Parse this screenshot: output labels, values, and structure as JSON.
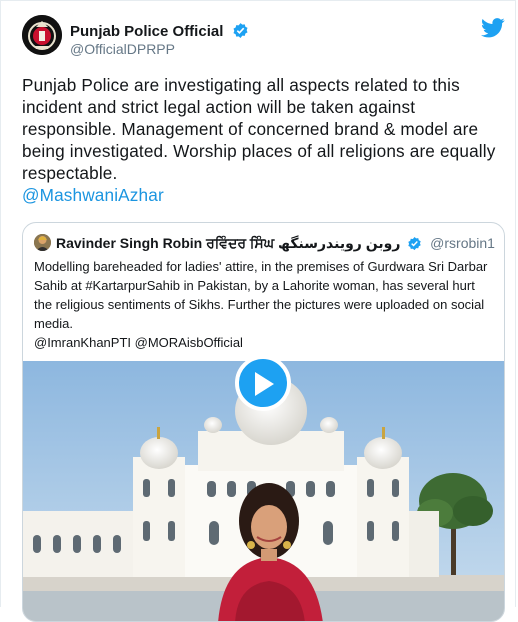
{
  "author": {
    "display_name": "Punjab Police Official",
    "handle": "@OfficialDPRPP",
    "avatar_icon": "punjab-police-emblem-icon",
    "verified": true
  },
  "tweet": {
    "text": "Punjab Police are investigating all aspects related to this incident and strict legal action will be taken against responsible. Management of  concerned brand & model are being investigated. Worship places of all religions are equally respectable.",
    "mention": "@MashwaniAzhar"
  },
  "quoted_tweet": {
    "display_name": "Ravinder Singh Robin ਰਵਿੰਦਰ ਸਿੰਘ روبن رویندرسنگھ",
    "handle": "@rsrobin1",
    "verified": true,
    "text": "Modelling bareheaded for ladies' attire, in the premises  of Gurdwara Sri Darbar Sahib at #KartarpurSahib in Pakistan, by a Lahorite woman,  has several hurt the religious sentiments of Sikhs. Further the pictures were uploaded on social media.",
    "mentions": "@ImranKhanPTI  @MORAisbOfficial",
    "media_icon": "video-thumbnail-gurdwara"
  },
  "colors": {
    "link": "#1b95e0",
    "twitter_blue": "#1da1f2",
    "text": "#14171a",
    "secondary": "#657786",
    "border": "#ccd6dd"
  }
}
